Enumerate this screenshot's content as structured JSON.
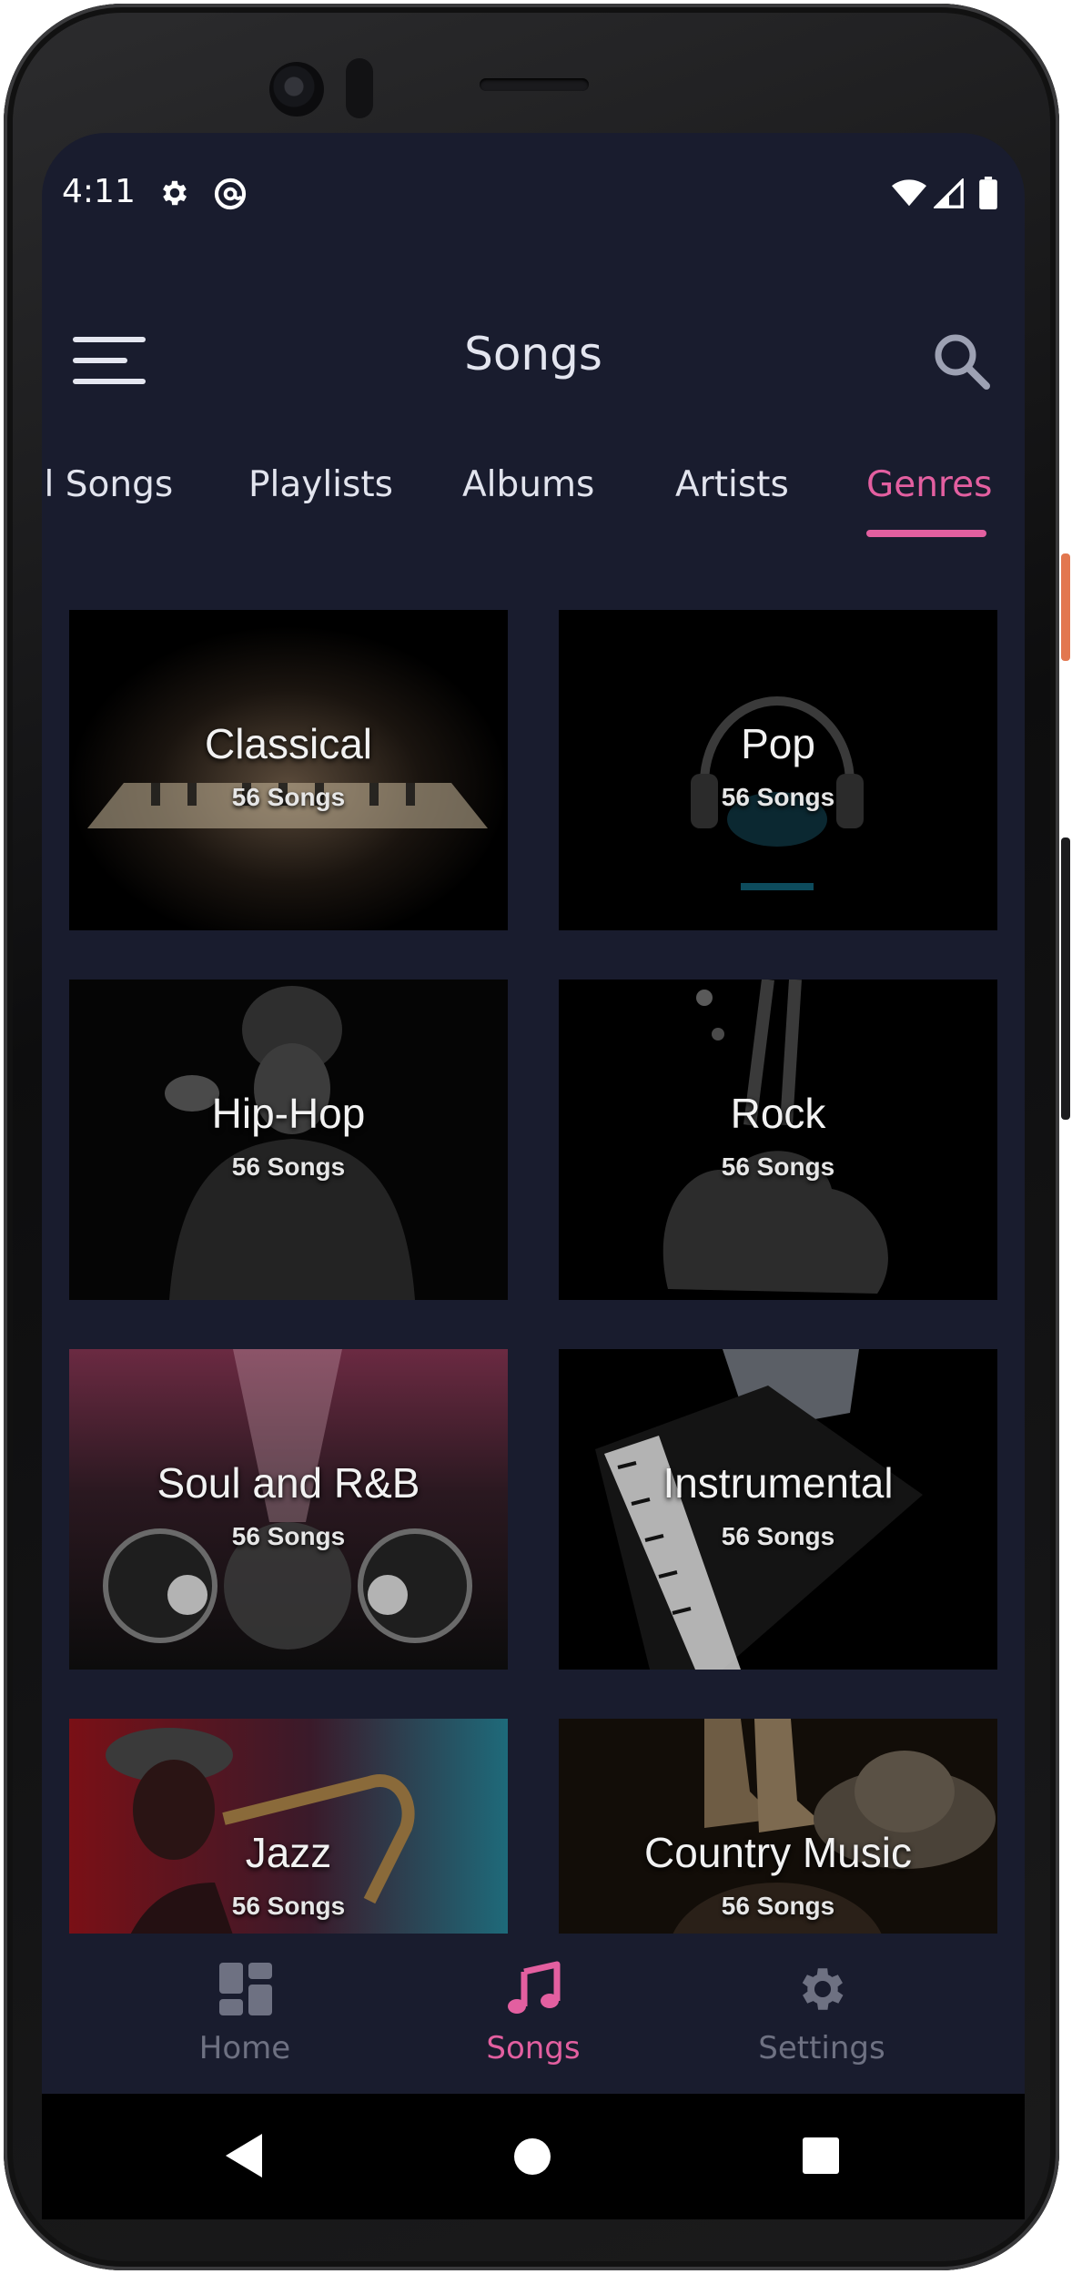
{
  "status_bar": {
    "time": "4:11"
  },
  "app_bar": {
    "title": "Songs"
  },
  "tabs": [
    {
      "label": "All Songs",
      "active": false
    },
    {
      "label": "Playlists",
      "active": false
    },
    {
      "label": "Albums",
      "active": false
    },
    {
      "label": "Artists",
      "active": false
    },
    {
      "label": "Genres",
      "active": true
    }
  ],
  "genres": [
    {
      "name": "Classical",
      "count": "56 Songs",
      "art": "piano-keys-image"
    },
    {
      "name": "Pop",
      "count": "56 Songs",
      "art": "headphones-image"
    },
    {
      "name": "Hip-Hop",
      "count": "56 Songs",
      "art": "rapper-image"
    },
    {
      "name": "Rock",
      "count": "56 Songs",
      "art": "guitar-image"
    },
    {
      "name": "Soul and R&B",
      "count": "56 Songs",
      "art": "concert-speakers-image"
    },
    {
      "name": "Instrumental",
      "count": "56 Songs",
      "art": "grand-piano-image"
    },
    {
      "name": "Jazz",
      "count": "56 Songs",
      "art": "saxophone-player-image"
    },
    {
      "name": "Country Music",
      "count": "56 Songs",
      "art": "boots-and-hat-image"
    }
  ],
  "bottom_nav": [
    {
      "label": "Home",
      "icon": "dashboard-icon",
      "active": false
    },
    {
      "label": "Songs",
      "icon": "music-note-icon",
      "active": true
    },
    {
      "label": "Settings",
      "icon": "gear-icon",
      "active": false
    }
  ],
  "colors": {
    "background": "#191c2e",
    "accent": "#e35fa0",
    "text": "#e4e6f0",
    "inactive": "#6e7182"
  }
}
